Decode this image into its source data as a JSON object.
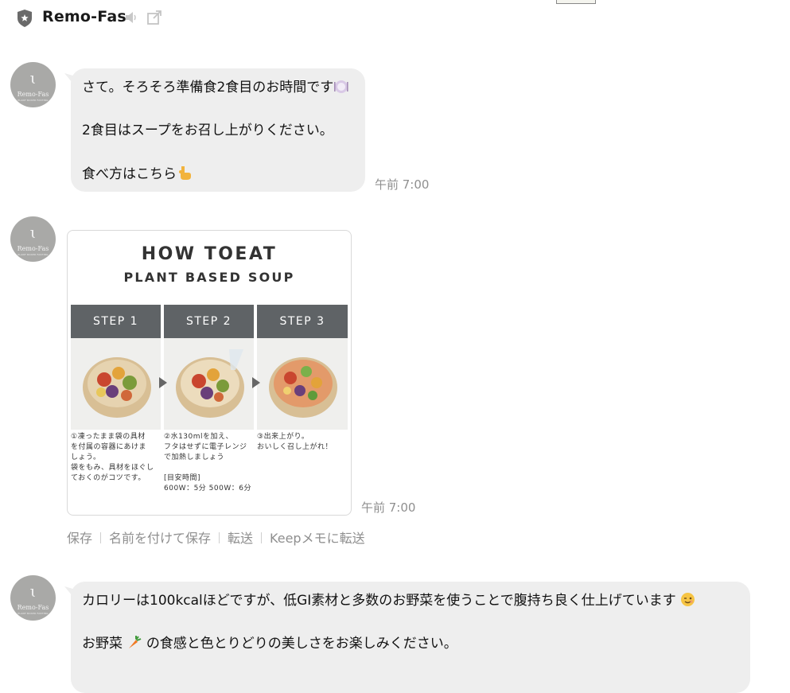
{
  "header": {
    "title": "Remo-Fas"
  },
  "avatar": {
    "mark": "ɩ",
    "name": "Remo-Fas",
    "sub": "PLANT BASED FASTING"
  },
  "messages": [
    {
      "lines": [
        "さて。そろそろ準備食2食目のお時間です",
        "2食目はスープをお召し上がりください。",
        "食べ方はこちら"
      ],
      "time": "午前 7:00"
    },
    {
      "image": {
        "title": "HOW TOEAT",
        "subtitle": "PLANT BASED SOUP",
        "steps": [
          {
            "label": "STEP 1",
            "text": "①凍ったまま袋の具材\nを付属の容器にあけま\nしょう。\n袋をもみ、具材をほぐし\nておくのがコツです。"
          },
          {
            "label": "STEP 2",
            "text": "②水130mlを加え、\nフタはせずに電子レンジ\nで加熱しましょう\n\n[目安時間]\n600W：5分 500W：6分"
          },
          {
            "label": "STEP 3",
            "text": "③出来上がり。\nおいしく召し上がれ！"
          }
        ]
      },
      "time": "午前 7:00",
      "actions": [
        "保存",
        "名前を付けて保存",
        "転送",
        "Keepメモに転送"
      ]
    },
    {
      "lines": [
        "カロリーは100kcalほどですが、低GI素材と多数のお野菜を使うことで腹持ち良く仕上げています",
        "お野菜",
        "の食感と色とりどりの美しさをお楽しみください。"
      ]
    }
  ],
  "icons": [
    "shield-star-icon",
    "speaker-icon",
    "popout-icon",
    "plate-emoji",
    "pointing-down-emoji",
    "wink-emoji",
    "carrot-emoji"
  ]
}
